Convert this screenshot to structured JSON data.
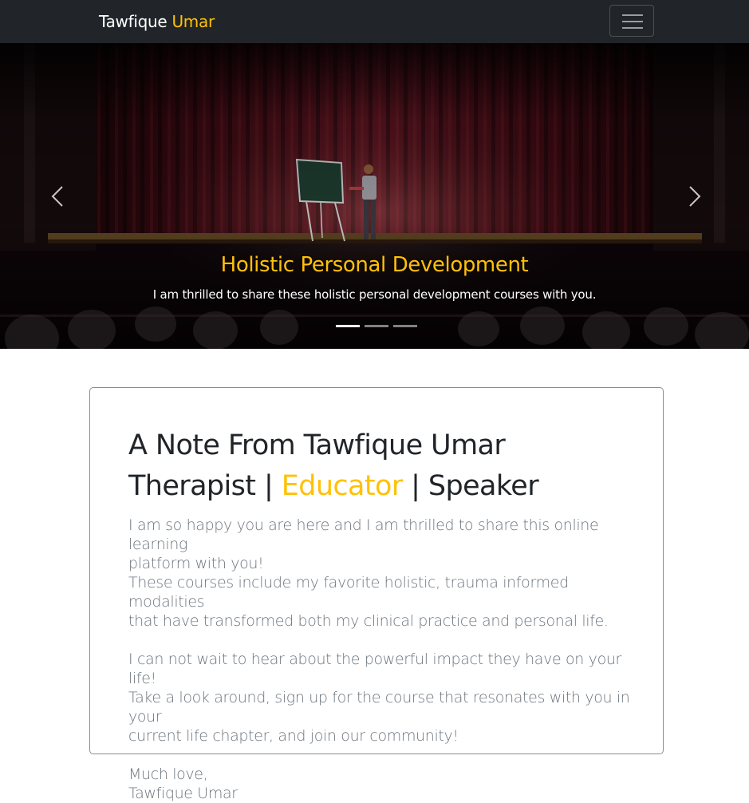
{
  "navbar": {
    "brand_first": "Tawfique",
    "brand_second": "Umar",
    "menu_icon": "hamburger-menu-icon"
  },
  "carousel": {
    "active_index": 0,
    "slide_count": 3,
    "caption_title": "Holistic Personal Development",
    "caption_text": "I am thrilled to share these holistic personal development courses with you.",
    "prev_icon": "chevron-left-icon",
    "next_icon": "chevron-right-icon"
  },
  "note": {
    "heading_line1": "A Note From Tawfique Umar",
    "heading_role1": "Therapist",
    "heading_sep1": " | ",
    "heading_role2": "Educator",
    "heading_sep2": " | ",
    "heading_role3": "Speaker",
    "para1_line1": "I am so happy you are here and I am thrilled to share this online learning",
    "para1_line2": "platform with you!",
    "para1_line3": "These courses include my favorite holistic, trauma informed modalities",
    "para1_line4": "that have transformed both my clinical practice and personal life.",
    "para2_line1": "I can not wait to hear about the powerful impact they have on your life!",
    "para2_line2": "Take a look around, sign up for the course that resonates with you in your",
    "para2_line3": "current life chapter, and join our community!",
    "signoff": "Much love,",
    "signature": "Tawfique Umar"
  },
  "colors": {
    "navbar_bg": "#212529",
    "accent": "#ffc107",
    "heading_text": "#212529",
    "body_text": "#6c757d"
  }
}
